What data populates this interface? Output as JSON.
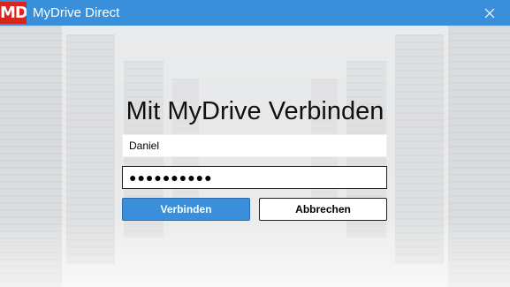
{
  "window": {
    "title": "MyDrive Direct",
    "logo_text": "MD",
    "close_icon": "close-icon"
  },
  "login": {
    "heading": "Mit MyDrive Verbinden",
    "username_value": "Daniel",
    "password_value": "●●●●●●●●●●",
    "connect_label": "Verbinden",
    "cancel_label": "Abbrechen"
  },
  "colors": {
    "titlebar": "#3a8fdb",
    "logo": "#d8261e",
    "primary_button": "#3a8fdb"
  }
}
